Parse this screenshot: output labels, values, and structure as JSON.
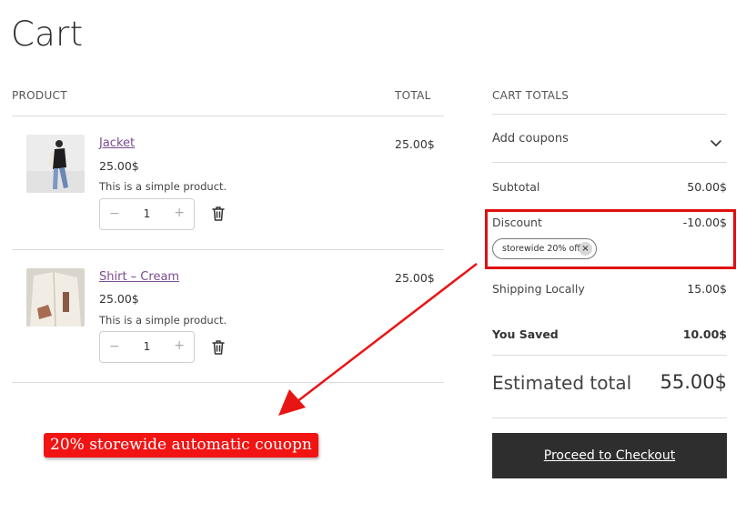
{
  "page": {
    "title": "Cart"
  },
  "cart": {
    "col_product": "PRODUCT",
    "col_total": "TOTAL",
    "items": [
      {
        "name": "Jacket",
        "price": "25.00$",
        "description": "This is a simple product.",
        "quantity": "1",
        "total": "25.00$"
      },
      {
        "name": "Shirt – Cream",
        "price": "25.00$",
        "description": "This is a simple product.",
        "quantity": "1",
        "total": "25.00$"
      }
    ],
    "qty_minus": "−",
    "qty_plus": "+"
  },
  "totals": {
    "heading": "CART TOTALS",
    "add_coupons": "Add coupons",
    "subtotal_label": "Subtotal",
    "subtotal_value": "50.00$",
    "discount_label": "Discount",
    "discount_value": "-10.00$",
    "coupon_chip": "storewide 20% off",
    "coupon_remove": "×",
    "shipping_label": "Shipping Locally",
    "shipping_value": "15.00$",
    "saved_label": "You Saved",
    "saved_value": "10.00$",
    "estimated_label": "Estimated total",
    "estimated_value": "55.00$",
    "checkout_label": "Proceed to Checkout"
  },
  "annotation": {
    "text": "20% storewide automatic couopn",
    "color": "#f21313"
  }
}
